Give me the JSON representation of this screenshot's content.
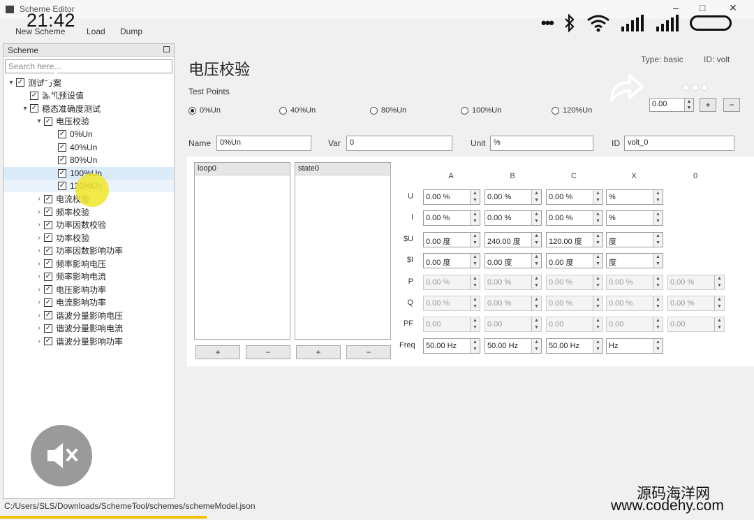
{
  "window": {
    "title": "Scheme Editor"
  },
  "phone": {
    "clock": "21:42"
  },
  "menu": [
    "New Scheme",
    "Load",
    "Dump"
  ],
  "scheme": {
    "header": "Scheme",
    "search_placeholder": "Search here...",
    "tree": [
      {
        "label": "测试方案",
        "level": 0,
        "expand": "v"
      },
      {
        "label": "源机预设值",
        "level": 1,
        "expand": ""
      },
      {
        "label": "稳态准确度测试",
        "level": 1,
        "expand": "v"
      },
      {
        "label": "电压校验",
        "level": 2,
        "expand": "v"
      },
      {
        "label": "0%Un",
        "level": 3,
        "expand": ""
      },
      {
        "label": "40%Un",
        "level": 3,
        "expand": ""
      },
      {
        "label": "80%Un",
        "level": 3,
        "expand": ""
      },
      {
        "label": "100%Un",
        "level": 3,
        "expand": ""
      },
      {
        "label": "120%Un",
        "level": 3,
        "expand": ""
      },
      {
        "label": "电流校验",
        "level": 2,
        "expand": ">"
      },
      {
        "label": "频率校验",
        "level": 2,
        "expand": ">"
      },
      {
        "label": "功率因数校验",
        "level": 2,
        "expand": ">"
      },
      {
        "label": "功率校验",
        "level": 2,
        "expand": ">"
      },
      {
        "label": "功率因数影响功率",
        "level": 2,
        "expand": ">"
      },
      {
        "label": "频率影响电压",
        "level": 2,
        "expand": ">"
      },
      {
        "label": "频率影响电流",
        "level": 2,
        "expand": ">"
      },
      {
        "label": "电压影响功率",
        "level": 2,
        "expand": ">"
      },
      {
        "label": "电流影响功率",
        "level": 2,
        "expand": ">"
      },
      {
        "label": "谐波分量影响电压",
        "level": 2,
        "expand": ">"
      },
      {
        "label": "谐波分量影响电流",
        "level": 2,
        "expand": ">"
      },
      {
        "label": "谐波分量影响功率",
        "level": 2,
        "expand": ">"
      }
    ]
  },
  "main": {
    "title": "电压校验",
    "type_text": "Type: basic",
    "id_text": "ID: volt",
    "test_points_label": "Test Points",
    "test_points": [
      "0%Un",
      "40%Un",
      "80%Un",
      "100%Un",
      "120%Un"
    ],
    "spin_value": "0.00",
    "add_symbol": "+",
    "remove_symbol": "−",
    "fields": {
      "name_label": "Name",
      "name_value": "0%Un",
      "var_label": "Var",
      "var_value": "0",
      "unit_label": "Unit",
      "unit_value": "%",
      "id_label": "ID",
      "id_value": "volt_0"
    },
    "loop_list_head": "loop0",
    "state_list_head": "state0",
    "grid": {
      "columns": [
        "A",
        "B",
        "C",
        "X",
        "0"
      ],
      "rows": [
        {
          "label": "U",
          "cells": [
            "0.00 %",
            "0.00 %",
            "0.00 %",
            "%"
          ],
          "disabled": false
        },
        {
          "label": "I",
          "cells": [
            "0.00 %",
            "0.00 %",
            "0.00 %",
            "%"
          ],
          "disabled": false
        },
        {
          "label": "$U",
          "cells": [
            "0.00 度",
            "240.00 度",
            "120.00 度",
            "度"
          ],
          "disabled": false
        },
        {
          "label": "$I",
          "cells": [
            "0.00 度",
            "0.00 度",
            "0.00 度",
            "度"
          ],
          "disabled": false
        },
        {
          "label": "P",
          "cells": [
            "0.00 %",
            "0.00 %",
            "0.00 %",
            "0.00 %",
            "0.00 %"
          ],
          "disabled": true
        },
        {
          "label": "Q",
          "cells": [
            "0.00 %",
            "0.00 %",
            "0.00 %",
            "0.00 %",
            "0.00 %"
          ],
          "disabled": true
        },
        {
          "label": "PF",
          "cells": [
            "0.00",
            "0.00",
            "0.00",
            "0.00",
            "0.00"
          ],
          "disabled": true
        },
        {
          "label": "Freq",
          "cells": [
            "50.00 Hz",
            "50.00 Hz",
            "50.00 Hz",
            "Hz"
          ],
          "disabled": false
        }
      ]
    }
  },
  "status": {
    "path": "C:/Users/SLS/Downloads/SchemeTool/schemes/schemeModel.json"
  },
  "watermark": {
    "line1": "源码海洋网",
    "line2": "www.codehy.com"
  }
}
